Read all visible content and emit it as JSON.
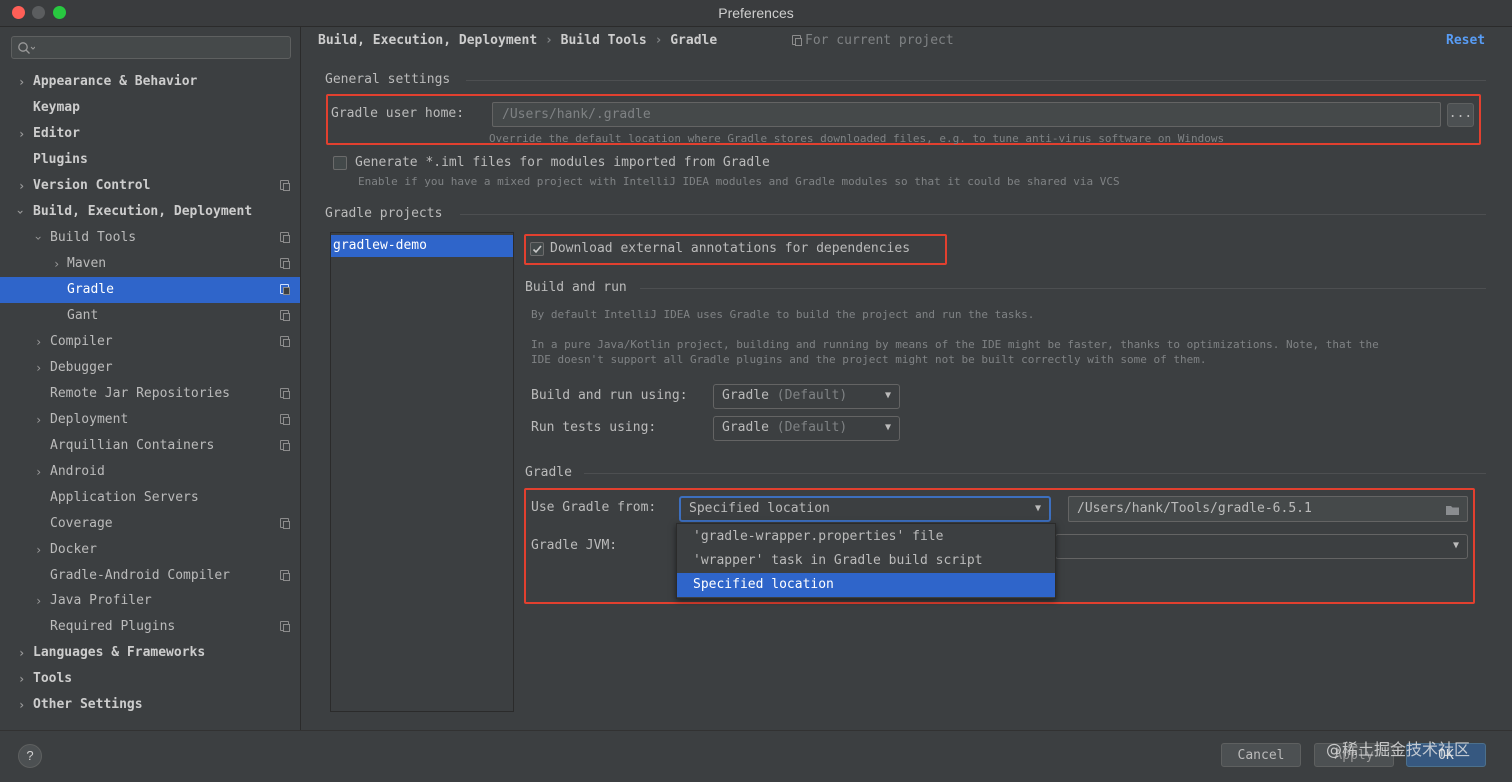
{
  "window": {
    "title": "Preferences"
  },
  "sidebar": {
    "search_placeholder": "",
    "items": [
      {
        "label": "Appearance & Behavior"
      },
      {
        "label": "Keymap"
      },
      {
        "label": "Editor"
      },
      {
        "label": "Plugins"
      },
      {
        "label": "Version Control"
      },
      {
        "label": "Build, Execution, Deployment"
      },
      {
        "label": "Build Tools"
      },
      {
        "label": "Maven"
      },
      {
        "label": "Gradle"
      },
      {
        "label": "Gant"
      },
      {
        "label": "Compiler"
      },
      {
        "label": "Debugger"
      },
      {
        "label": "Remote Jar Repositories"
      },
      {
        "label": "Deployment"
      },
      {
        "label": "Arquillian Containers"
      },
      {
        "label": "Android"
      },
      {
        "label": "Application Servers"
      },
      {
        "label": "Coverage"
      },
      {
        "label": "Docker"
      },
      {
        "label": "Gradle-Android Compiler"
      },
      {
        "label": "Java Profiler"
      },
      {
        "label": "Required Plugins"
      },
      {
        "label": "Languages & Frameworks"
      },
      {
        "label": "Tools"
      },
      {
        "label": "Other Settings"
      }
    ],
    "selected": "Gradle"
  },
  "header": {
    "breadcrumb": [
      "Build, Execution, Deployment",
      "Build Tools",
      "Gradle"
    ],
    "separator": "›",
    "scope_label": "For current project",
    "reset_label": "Reset"
  },
  "general": {
    "section_title": "General settings",
    "user_home_label": "Gradle user home:",
    "user_home_placeholder": "/Users/hank/.gradle",
    "browse_label": "...",
    "user_home_hint": "Override the default location where Gradle stores downloaded files, e.g. to tune anti-virus software on Windows",
    "iml_label": "Generate *.iml files for modules imported from Gradle",
    "iml_checked": false,
    "iml_hint": "Enable if you have a mixed project with IntelliJ IDEA modules and Gradle modules so that it could be shared via VCS"
  },
  "projects": {
    "section_title": "Gradle projects",
    "list": [
      "gradlew-demo"
    ],
    "download_annotations_label": "Download external annotations for dependencies",
    "download_annotations_checked": true,
    "build_run_title": "Build and run",
    "build_run_desc1": "By default IntelliJ IDEA uses Gradle to build the project and run the tasks.",
    "build_run_desc2a": "In a pure Java/Kotlin project, building and running by means of the IDE might be faster, thanks to optimizations. Note, that the",
    "build_run_desc2b": "IDE doesn't support all Gradle plugins and the project might not be built correctly with some of them.",
    "build_using_label": "Build and run using:",
    "build_using_value": "Gradle",
    "build_using_suffix": "(Default)",
    "tests_using_label": "Run tests using:",
    "tests_using_value": "Gradle",
    "tests_using_suffix": "(Default)",
    "gradle_title": "Gradle",
    "use_from_label": "Use Gradle from:",
    "use_from_value": "Specified location",
    "location_value": "/Users/hank/Tools/gradle-6.5.1",
    "jvm_label": "Gradle JVM:",
    "dropdown_options": [
      "'gradle-wrapper.properties' file",
      "'wrapper' task in Gradle build script",
      "Specified location"
    ],
    "dropdown_selected": "Specified location"
  },
  "footer": {
    "help_label": "?",
    "cancel_label": "Cancel",
    "apply_label": "Apply",
    "ok_label": "OK",
    "watermark": "@稀土掘金技术社区"
  },
  "colors": {
    "accent": "#2f65ca",
    "highlight_box": "#e2402f",
    "link": "#589df6"
  }
}
